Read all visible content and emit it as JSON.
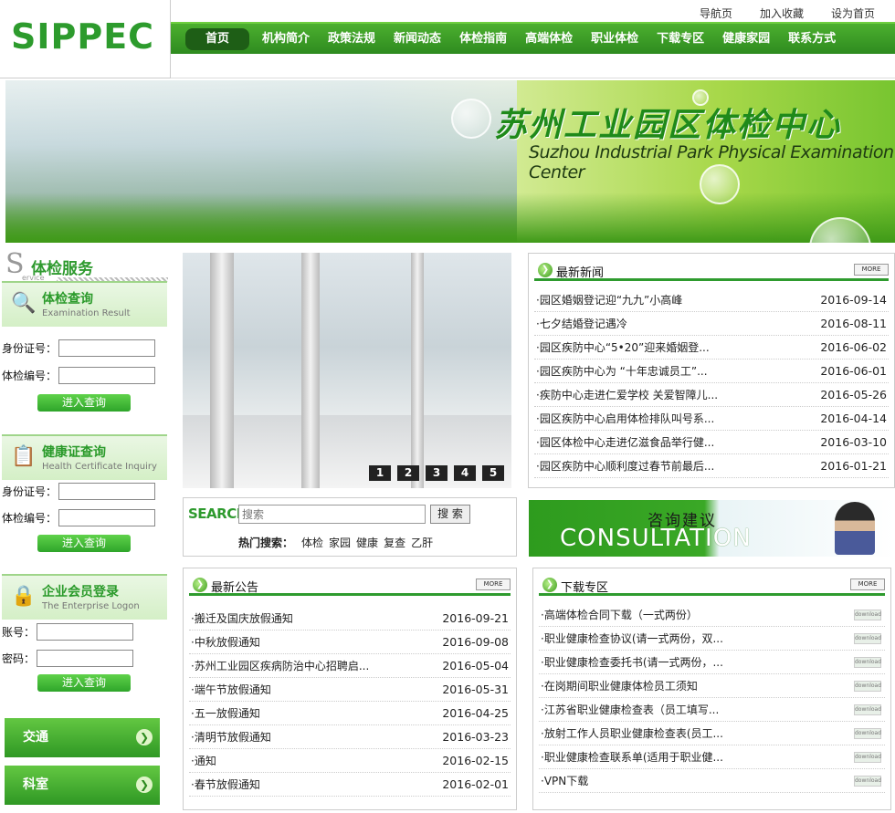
{
  "logo": {
    "text": "SIPPEC"
  },
  "top_links": [
    "导航页",
    "加入收藏",
    "设为首页"
  ],
  "nav": [
    "首页",
    "机构简介",
    "政策法规",
    "新闻动态",
    "体检指南",
    "高端体检",
    "职业体检",
    "下载专区",
    "健康家园",
    "联系方式"
  ],
  "banner": {
    "title_cn": "苏州工业园区体检中心",
    "title_en": "Suzhou Industrial Park Physical  Examination Center"
  },
  "services": {
    "s_letter": "S",
    "title": "体检服务",
    "subtitle": "ervice",
    "exam_query": {
      "title": "体检查询",
      "subtitle": "Examination Result",
      "id_label": "身份证号：",
      "no_label": "体检编号：",
      "button": "进入查询"
    },
    "health_cert": {
      "title": "健康证查询",
      "subtitle": "Health Certificate Inquiry",
      "id_label": "身份证号：",
      "no_label": "体检编号：",
      "button": "进入查询"
    },
    "member": {
      "title": "企业会员登录",
      "subtitle": "The Enterprise Logon",
      "account_label": "账号：",
      "password_label": "密码：",
      "button": "进入查询"
    },
    "side_buttons": [
      "交通",
      "科室"
    ]
  },
  "slider": {
    "pages": [
      "1",
      "2",
      "3",
      "4",
      "5"
    ]
  },
  "latest_news": {
    "title": "最新新闻",
    "more": "MORE",
    "items": [
      {
        "text": "·园区婚姻登记迎“九九”小高峰",
        "date": "2016-09-14"
      },
      {
        "text": "·七夕结婚登记遇冷",
        "date": "2016-08-11"
      },
      {
        "text": "·园区疾防中心“5•20”迎来婚姻登...",
        "date": "2016-06-02"
      },
      {
        "text": "·园区疾防中心为 “十年忠诚员工”...",
        "date": "2016-06-01"
      },
      {
        "text": "·疾防中心走进仁爱学校 关爱智障儿...",
        "date": "2016-05-26"
      },
      {
        "text": "·园区疾防中心启用体检排队叫号系...",
        "date": "2016-04-14"
      },
      {
        "text": "·园区体检中心走进亿滋食品举行健...",
        "date": "2016-03-10"
      },
      {
        "text": "·园区疾防中心顺利度过春节前最后...",
        "date": "2016-01-21"
      }
    ]
  },
  "search": {
    "label": "SEARCH",
    "placeholder": "搜索",
    "button": "搜 索",
    "hot_label": "热门搜索：",
    "hot_terms": [
      "体检",
      "家园",
      "健康",
      "复查",
      "乙肝"
    ]
  },
  "consult": {
    "cn": "咨询建议",
    "en": "CONSULTATION"
  },
  "notices": {
    "title": "最新公告",
    "more": "MORE",
    "items": [
      {
        "text": "·搬迁及国庆放假通知",
        "date": "2016-09-21"
      },
      {
        "text": "·中秋放假通知",
        "date": "2016-09-08"
      },
      {
        "text": "·苏州工业园区疾病防治中心招聘启...",
        "date": "2016-05-04"
      },
      {
        "text": "·端午节放假通知",
        "date": "2016-05-31"
      },
      {
        "text": "·五一放假通知",
        "date": "2016-04-25"
      },
      {
        "text": "·清明节放假通知",
        "date": "2016-03-23"
      },
      {
        "text": "·通知",
        "date": "2016-02-15"
      },
      {
        "text": "·春节放假通知",
        "date": "2016-02-01"
      }
    ]
  },
  "downloads": {
    "title": "下载专区",
    "more": "MORE",
    "badge": "download",
    "items": [
      "·高端体检合同下载（一式两份）",
      "·职业健康检查协议(请一式两份，双...",
      "·职业健康检查委托书(请一式两份，...",
      "·在岗期间职业健康体检员工须知",
      "·江苏省职业健康检查表（员工填写...",
      "·放射工作人员职业健康检查表(员工...",
      "·职业健康检查联系单(适用于职业健...",
      "·VPN下载"
    ]
  }
}
